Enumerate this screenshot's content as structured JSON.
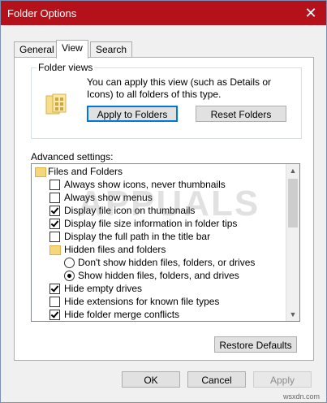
{
  "window": {
    "title": "Folder Options"
  },
  "tabs": [
    {
      "label": "General"
    },
    {
      "label": "View"
    },
    {
      "label": "Search"
    }
  ],
  "folder_views": {
    "legend": "Folder views",
    "description": "You can apply this view (such as Details or Icons) to all folders of this type.",
    "apply_label": "Apply to Folders",
    "reset_label": "Reset Folders"
  },
  "advanced": {
    "label": "Advanced settings:",
    "items": [
      {
        "type": "folder",
        "label": "Files and Folders",
        "indent": 0
      },
      {
        "type": "checkbox",
        "checked": false,
        "label": "Always show icons, never thumbnails",
        "indent": 1
      },
      {
        "type": "checkbox",
        "checked": false,
        "label": "Always show menus",
        "indent": 1
      },
      {
        "type": "checkbox",
        "checked": true,
        "label": "Display file icon on thumbnails",
        "indent": 1
      },
      {
        "type": "checkbox",
        "checked": true,
        "label": "Display file size information in folder tips",
        "indent": 1
      },
      {
        "type": "checkbox",
        "checked": false,
        "label": "Display the full path in the title bar",
        "indent": 1
      },
      {
        "type": "folder",
        "label": "Hidden files and folders",
        "indent": 1
      },
      {
        "type": "radio",
        "checked": false,
        "label": "Don't show hidden files, folders, or drives",
        "indent": 2
      },
      {
        "type": "radio",
        "checked": true,
        "label": "Show hidden files, folders, and drives",
        "indent": 2
      },
      {
        "type": "checkbox",
        "checked": true,
        "label": "Hide empty drives",
        "indent": 1
      },
      {
        "type": "checkbox",
        "checked": false,
        "label": "Hide extensions for known file types",
        "indent": 1
      },
      {
        "type": "checkbox",
        "checked": true,
        "label": "Hide folder merge conflicts",
        "indent": 1
      }
    ]
  },
  "buttons": {
    "restore": "Restore Defaults",
    "ok": "OK",
    "cancel": "Cancel",
    "apply": "Apply"
  },
  "watermark": "APPUALS",
  "footer_site": "wsxdn.com"
}
